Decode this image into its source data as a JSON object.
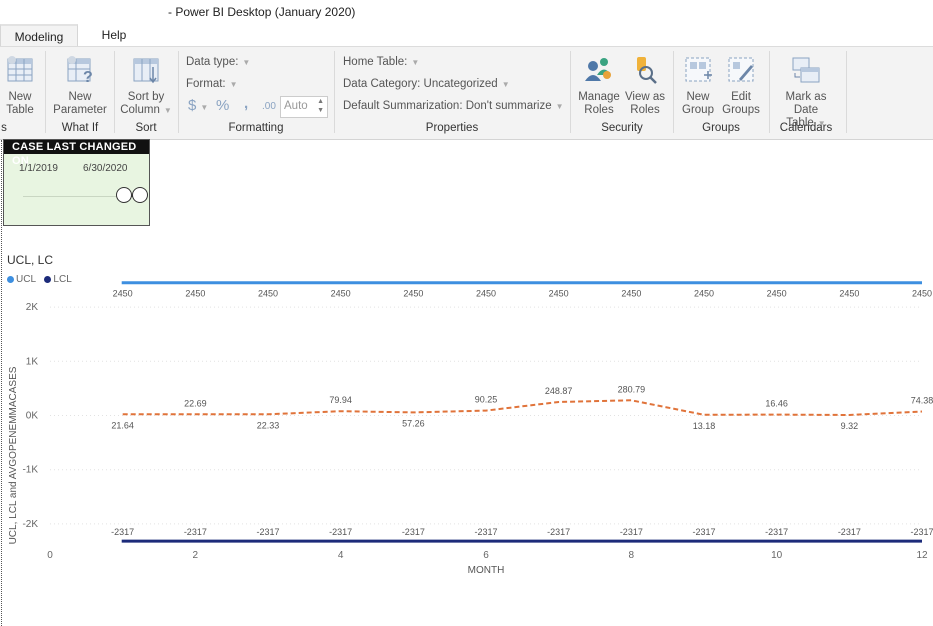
{
  "window": {
    "title": "- Power BI Desktop (January 2020)"
  },
  "tabs": [
    {
      "label": "Modeling"
    },
    {
      "label": "Help"
    }
  ],
  "ribbon": {
    "cut_group_label": "s",
    "new_table": {
      "line1": "New",
      "line2": "Table"
    },
    "new_parameter": {
      "line1": "New",
      "line2": "Parameter"
    },
    "what_if_label": "What If",
    "sort_by_column": {
      "line1": "Sort by",
      "line2": "Column"
    },
    "sort_label": "Sort",
    "data_type": "Data type:",
    "format": "Format:",
    "currency_symbol": "$",
    "percent_symbol": "%",
    "comma_symbol": ",",
    "decimal_symbol": ".00",
    "decimal_value": "Auto",
    "formatting_label": "Formatting",
    "home_table": "Home Table:",
    "data_category": "Data Category: Uncategorized",
    "default_summarization": "Default Summarization: Don't summarize",
    "properties_label": "Properties",
    "manage_roles": {
      "line1": "Manage",
      "line2": "Roles"
    },
    "view_as_roles": {
      "line1": "View as",
      "line2": "Roles"
    },
    "security_label": "Security",
    "new_group": {
      "line1": "New",
      "line2": "Group"
    },
    "edit_groups": {
      "line1": "Edit",
      "line2": "Groups"
    },
    "groups_label": "Groups",
    "mark_as_date_table": {
      "line1": "Mark as",
      "line2": "Date Table"
    },
    "calendars_label": "Calendars"
  },
  "slicer": {
    "title": "CASE LAST CHANGED ON",
    "start_date": "1/1/2019",
    "end_date": "6/30/2020",
    "start_position": 0.86,
    "end_position": 1.0
  },
  "chart_data": {
    "type": "line",
    "title": "UCL, LC",
    "xlabel": "MONTH",
    "ylabel": "UCL, LCL and AVGOPENEMMACASES",
    "xlim": [
      0,
      12
    ],
    "ylim": [
      -2500,
      2500
    ],
    "x_ticks": [
      "0",
      "2",
      "4",
      "6",
      "8",
      "10",
      "12"
    ],
    "y_ticks": [
      {
        "value": 2000,
        "label": "2K"
      },
      {
        "value": 1000,
        "label": "1K"
      },
      {
        "value": 0,
        "label": "0K"
      },
      {
        "value": -1000,
        "label": "-1K"
      },
      {
        "value": -2000,
        "label": "-2K"
      }
    ],
    "grid": true,
    "legend_position": "top-left",
    "x": [
      1,
      2,
      3,
      4,
      5,
      6,
      7,
      8,
      9,
      10,
      11,
      12
    ],
    "series": [
      {
        "name": "UCL",
        "color": "#3d8fe0",
        "style": "solid",
        "values": [
          2450,
          2450,
          2450,
          2450,
          2450,
          2450,
          2450,
          2450,
          2450,
          2450,
          2450,
          2450
        ],
        "labels": [
          "2450",
          "2450",
          "2450",
          "2450",
          "2450",
          "2450",
          "2450",
          "2450",
          "2450",
          "2450",
          "2450",
          "2450"
        ]
      },
      {
        "name": "LCL",
        "color": "#1c2b7a",
        "style": "solid",
        "values": [
          -2317,
          -2317,
          -2317,
          -2317,
          -2317,
          -2317,
          -2317,
          -2317,
          -2317,
          -2317,
          -2317,
          -2317
        ],
        "labels": [
          "-2317",
          "-2317",
          "-2317",
          "-2317",
          "-2317",
          "-2317",
          "-2317",
          "-2317",
          "-2317",
          "-2317",
          "-2317",
          "-2317"
        ]
      },
      {
        "color": "#e0733a",
        "style": "dashed",
        "values": [
          21.64,
          22.69,
          22.33,
          79.94,
          57.26,
          90.25,
          248.87,
          280.79,
          13.18,
          16.46,
          9.32,
          74.38
        ],
        "labels": [
          "21.64",
          "22.69",
          "22.33",
          "79.94",
          "57.26",
          "90.25",
          "248.87",
          "280.79",
          "13.18",
          "16.46",
          "9.32",
          "74.38"
        ],
        "label_side": [
          "below",
          "above",
          "below",
          "above",
          "below",
          "above",
          "above",
          "above",
          "below",
          "above",
          "below",
          "above"
        ]
      }
    ]
  }
}
